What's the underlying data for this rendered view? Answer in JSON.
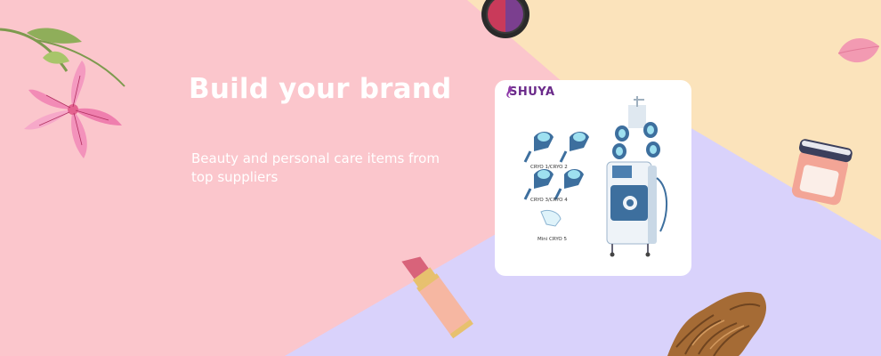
{
  "banner": {
    "headline": "Build your brand",
    "subtext": "Beauty and personal care items from top suppliers",
    "colors": {
      "pink": "#fbc6cc",
      "cream": "#fbe3bb",
      "lavender": "#d9d2fb",
      "text": "#ffffff"
    }
  },
  "product_card": {
    "brand": "SHUYA",
    "labels": {
      "pair1": "CRYO 1/CRYO 2",
      "pair2": "CRYO 3/CRYO 4",
      "mini": "Mini CRYO 5"
    }
  },
  "decorations": {
    "top_left": "lily-flower-icon",
    "top_center": "eyeshadow-compact-icon",
    "top_right": "petal-icon",
    "right": "cream-jar-icon",
    "bottom_center": "lipstick-icon",
    "bottom_right": "hair-extension-icon"
  }
}
